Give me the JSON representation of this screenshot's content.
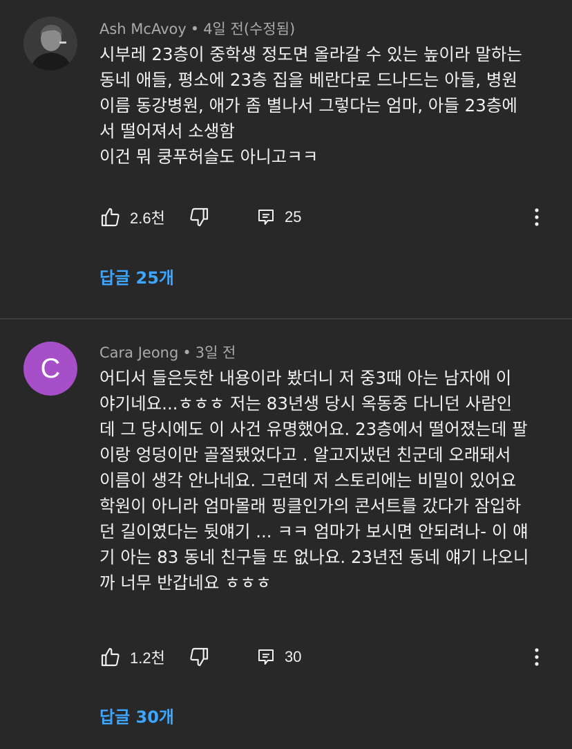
{
  "comments": [
    {
      "author": "Ash McAvoy",
      "time": "4일 전(수정됨)",
      "avatar_type": "photo",
      "lines": [
        "시부레 23층이 중학생 정도면 올라갈 수 있는 높이라 말하는",
        "동네 애들, 평소에 23층 집을 베란다로 드나드는 아들, 병원",
        "이름 동강병원, 애가 좀 별나서 그렇다는 엄마, 아들 23층에",
        "서 떨어져서 소생함",
        "이건 뭐 쿵푸허슬도 아니고ㅋㅋ"
      ],
      "likes": "2.6천",
      "reply_count": "25",
      "replies_label": "답글 25개"
    },
    {
      "author": "Cara Jeong",
      "time": "3일 전",
      "avatar_type": "letter",
      "avatar_letter": "C",
      "avatar_color": "#a64fc8",
      "lines": [
        "어디서 들은듯한 내용이라 봤더니 저 중3때 아는 남자애 이",
        "야기네요...ㅎㅎㅎ 저는 83년생 당시 옥동중 다니던 사람인",
        "데 그 당시에도 이 사건 유명했어요. 23층에서 떨어졌는데 팔",
        "이랑 엉덩이만 골절됐었다고 . 알고지냈던 친군데 오래돼서",
        "이름이 생각 안나네요. 그런데 저 스토리에는 비밀이 있어요",
        "학원이 아니라 엄마몰래 핑클인가의 콘서트를 갔다가 잠입하",
        "던 길이였다는 뒷얘기 ... ㅋㅋ 엄마가 보시면 안되려나- 이 얘",
        "기 아는 83 동네 친구들 또 없나요. 23년전 동네 얘기 나오니",
        "까 너무 반갑네요 ㅎㅎㅎ"
      ],
      "likes": "1.2천",
      "reply_count": "30",
      "replies_label": "답글 30개"
    }
  ],
  "colors": {
    "background": "#282828",
    "text": "#f1f1f1",
    "meta": "#aaaaaa",
    "link": "#3ea6ff",
    "divider": "#3d3d3d"
  },
  "icons": [
    "thumb-up-icon",
    "thumb-down-icon",
    "reply-icon",
    "more-vert-icon"
  ]
}
